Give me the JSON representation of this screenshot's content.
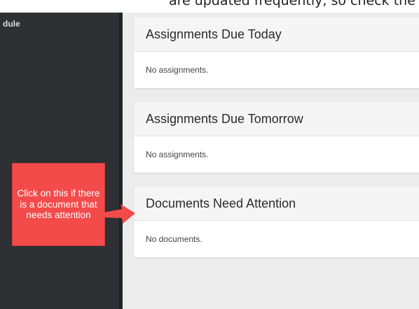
{
  "page_top": {
    "text": "are updated frequently, so check the navigation regularly."
  },
  "sidebar": {
    "visible_label": "dule"
  },
  "cards": [
    {
      "title": "Assignments Due Today",
      "body": "No assignments."
    },
    {
      "title": "Assignments Due Tomorrow",
      "body": "No assignments."
    },
    {
      "title": "Documents Need Attention",
      "body": "No documents."
    }
  ],
  "annotation": {
    "text": "Click on this if there is a document that needs attention",
    "color": "#f34a4a"
  }
}
